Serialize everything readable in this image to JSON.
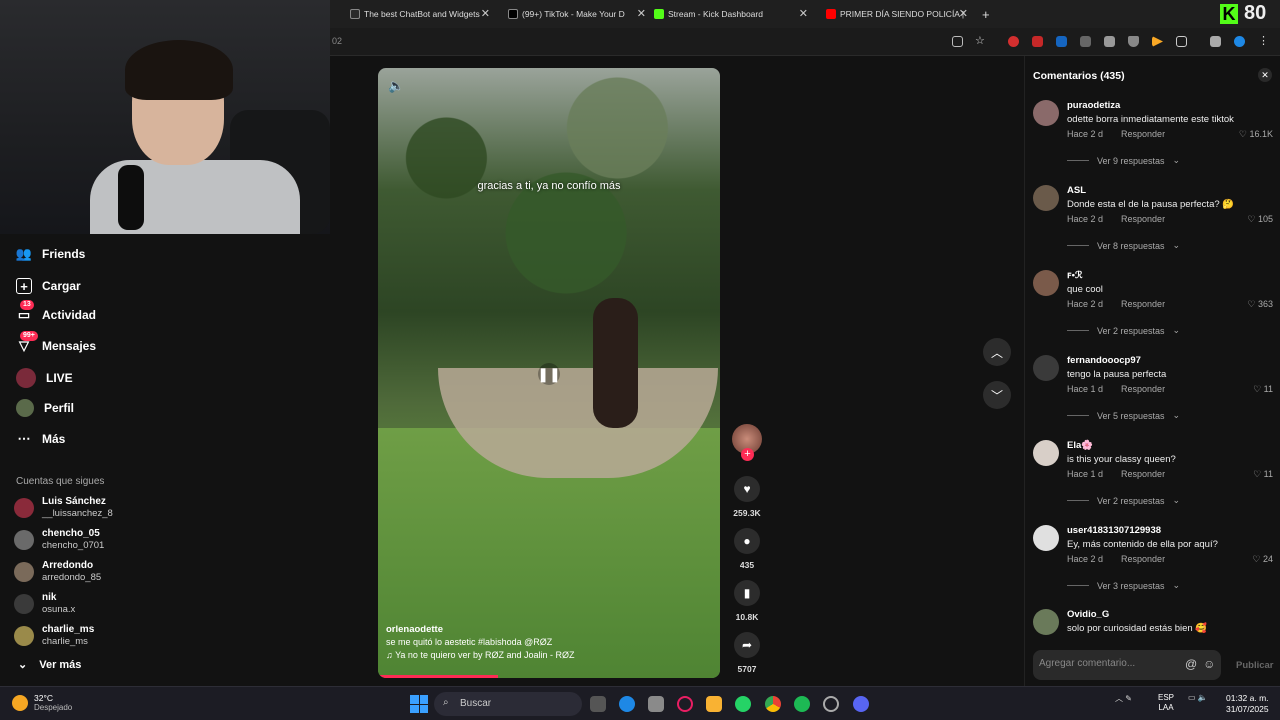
{
  "browser": {
    "tabs": [
      {
        "label": "The best ChatBot and Widgets",
        "fav": "#2b2b2b"
      },
      {
        "label": "(99+) TikTok - Make Your D",
        "fav": "#000000"
      },
      {
        "label": "Stream - Kick Dashboard",
        "fav": "#53fc18"
      },
      {
        "label": "PRIMER DÍA SIENDO POLICÍA |",
        "fav": "#ff0000"
      }
    ],
    "new_tab": "+",
    "url_fragment": "02",
    "kick_counter": "80"
  },
  "sidebar": {
    "items": [
      {
        "label": "Friends",
        "icon": "friends-icon"
      },
      {
        "label": "Cargar",
        "icon": "upload-icon"
      },
      {
        "label": "Actividad",
        "icon": "activity-icon",
        "badge": "13"
      },
      {
        "label": "Mensajes",
        "icon": "messages-icon",
        "badge": "99+"
      },
      {
        "label": "LIVE",
        "icon": "live-icon"
      },
      {
        "label": "Perfil",
        "icon": "profile-icon"
      },
      {
        "label": "Más",
        "icon": "more-icon"
      }
    ],
    "following_label": "Cuentas que sigues",
    "following": [
      {
        "name": "Luis Sánchez",
        "handle": "__luissanchez_8"
      },
      {
        "name": "chencho_05",
        "handle": "chencho_0701"
      },
      {
        "name": "Arredondo",
        "handle": "arredondo_85"
      },
      {
        "name": "nik",
        "handle": "osuna.x"
      },
      {
        "name": "charlie_ms",
        "handle": "charlie_ms"
      }
    ],
    "see_more": "Ver más"
  },
  "video": {
    "overlay_text": "gracias a ti, ya no confío más",
    "author": "orlenaodette",
    "caption": "se me quitó lo aestetic #labishoda  @RØZ",
    "music": "♫  Ya no te quiero ver by RØZ and Joalin - RØZ",
    "progress": 0.35
  },
  "actions": {
    "likes": "259.3K",
    "comments": "435",
    "saves": "10.8K",
    "shares": "5707"
  },
  "comments": {
    "title": "Comentarios (435)",
    "list": [
      {
        "user": "puraodetiza",
        "text": "odette borra inmediatamente este tiktok",
        "time": "Hace 2 d",
        "likes": "16.1K",
        "replies": "Ver 9 respuestas"
      },
      {
        "user": "ASL",
        "text": "Donde esta el de la pausa perfecta? 🤔",
        "time": "Hace 2 d",
        "likes": "105",
        "replies": "Ver 8 respuestas"
      },
      {
        "user": "ꜰ•ℛ",
        "text": "que cool",
        "time": "Hace 2 d",
        "likes": "363",
        "replies": "Ver 2 respuestas"
      },
      {
        "user": "fernandooocp97",
        "text": "tengo la pausa perfecta",
        "time": "Hace 1 d",
        "likes": "11",
        "replies": "Ver 5 respuestas"
      },
      {
        "user": "Ela🌸",
        "text": "is this your classy queen?",
        "time": "Hace 1 d",
        "likes": "11",
        "replies": "Ver 2 respuestas"
      },
      {
        "user": "user41831307129938",
        "text": "Ey, más contenido de ella por aquí?",
        "time": "Hace 2 d",
        "likes": "24",
        "replies": "Ver 3 respuestas"
      },
      {
        "user": "Ovidio_G",
        "text": "solo por curiosidad estás bien 🥰",
        "time": "",
        "likes": "",
        "replies": ""
      }
    ],
    "reply_label": "Responder",
    "input_placeholder": "Agregar comentario...",
    "post_label": "Publicar"
  },
  "taskbar": {
    "temp": "32°C",
    "weather": "Despejado",
    "search": "Buscar",
    "lang1": "ESP",
    "lang2": "LAA",
    "time": "01:32 a. m.",
    "date": "31/07/2025"
  }
}
